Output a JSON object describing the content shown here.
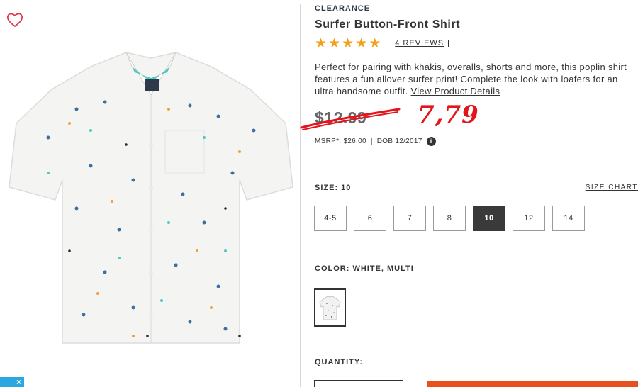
{
  "product": {
    "eyebrow": "CLEARANCE",
    "title": "Surfer Button-Front Shirt",
    "rating": 5,
    "reviews_label": "4 REVIEWS",
    "description": "Perfect for pairing with khakis, overalls, shorts and more, this poplin shirt features a fun allover surfer print! Complete the look with loafers for an ultra handsome outfit.",
    "details_link": "View Product Details",
    "old_price": "$12.99",
    "handwritten_price": "7,79",
    "msrp_label": "MSRP*: $26.00",
    "separator": "|",
    "dob_label": "DOB 12/2017",
    "info_icon_glyph": "i"
  },
  "size": {
    "label": "SIZE: 10",
    "chart_link": "SIZE CHART",
    "options": [
      "4-5",
      "6",
      "7",
      "8",
      "10",
      "12",
      "14"
    ],
    "selected": "10"
  },
  "color": {
    "label": "COLOR: WHITE, MULTI",
    "swatch_name": "white-multi-swatch"
  },
  "quantity": {
    "label": "QUANTITY:"
  },
  "ui": {
    "close_glyph": "×",
    "accent_color": "#e8501e",
    "heart_color": "#e0364f",
    "handwritten_color": "#e3141a",
    "star_color": "#f4a01c",
    "close_tab_color": "#2aa6e0"
  }
}
